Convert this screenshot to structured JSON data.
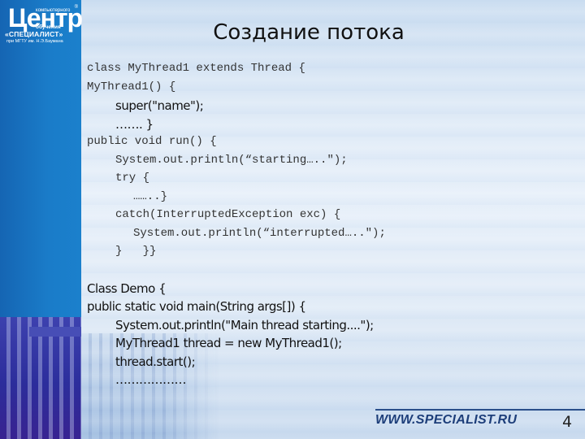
{
  "logo": {
    "big": "Центр",
    "top_small": "компьютерного",
    "mid_small": "обучения",
    "specialist": "«СПЕЦИАЛИСТ»",
    "under": "при МГТУ им. Н.Э.Баумана",
    "reg": "®"
  },
  "slide": {
    "title": "Создание потока",
    "code_lines": [
      {
        "text": "class MyThread1 extends Thread {",
        "style": "mono",
        "indent": 0
      },
      {
        "text": "MyThread1() {",
        "style": "mono",
        "indent": 0
      },
      {
        "text": "super(\"name\");",
        "style": "sans",
        "indent": 1
      },
      {
        "text": "……. }",
        "style": "sans",
        "indent": 1
      },
      {
        "text": "public void run() {",
        "style": "mono",
        "indent": 0
      },
      {
        "text": "System.out.println(“starting…..\");",
        "style": "mono",
        "indent": 1
      },
      {
        "text": "try {",
        "style": "mono",
        "indent": 1
      },
      {
        "text": "……..}",
        "style": "mono",
        "indent": 2
      },
      {
        "text": "catch(InterruptedException exc) {",
        "style": "mono",
        "indent": 1
      },
      {
        "text": "System.out.println(“interrupted…..\");",
        "style": "mono",
        "indent": 2
      },
      {
        "text": "}   }}",
        "style": "mono",
        "indent": 1
      },
      {
        "text": "",
        "style": "gap",
        "indent": 0
      },
      {
        "text": "Class Demo {",
        "style": "sans",
        "indent": 0
      },
      {
        "text": "public static void main(String args[]) {",
        "style": "sans",
        "indent": 0
      },
      {
        "text": "System.out.println(\"Main thread starting....\");",
        "style": "sans",
        "indent": 1
      },
      {
        "text": "MyThread1 thread = new MyThread1();",
        "style": "sans",
        "indent": 1
      },
      {
        "text": "thread.start();",
        "style": "sans",
        "indent": 1
      },
      {
        "text": "………………",
        "style": "sans",
        "indent": 1
      }
    ]
  },
  "footer": {
    "url": "WWW.SPECIALIST.RU",
    "page_number": "4"
  },
  "colors": {
    "brand_blue": "#1a7cc9",
    "footer_blue": "#1d3e7a"
  }
}
